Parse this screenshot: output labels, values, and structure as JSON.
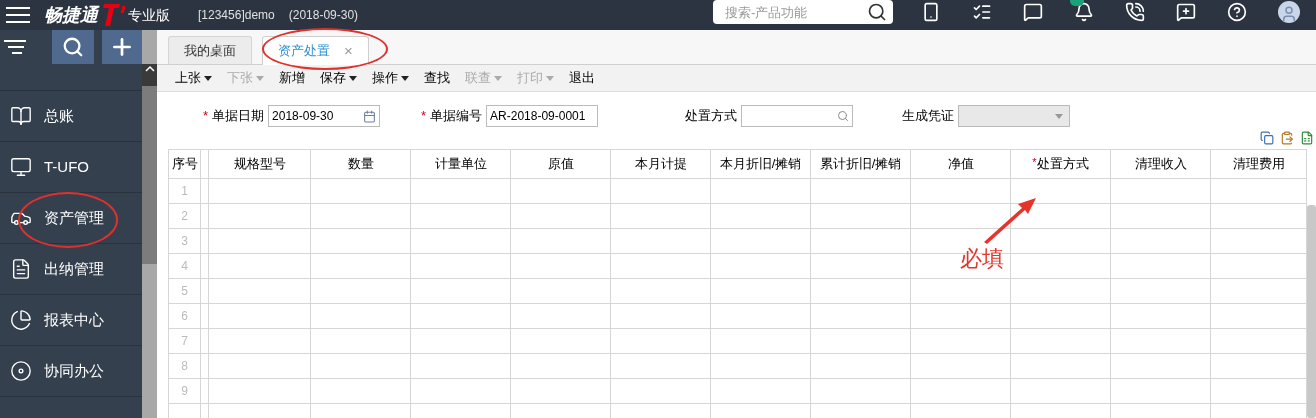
{
  "header": {
    "logo": "畅捷通",
    "edition": "专业版",
    "account": "[123456]demo",
    "date": "(2018-09-30)",
    "search": {
      "placeholder": "搜索-产品功能"
    }
  },
  "sidebar": {
    "items": [
      {
        "label": "总账",
        "selected": false
      },
      {
        "label": "T-UFO",
        "selected": false
      },
      {
        "label": "资产管理",
        "selected": false
      },
      {
        "label": "出纳管理",
        "selected": false
      },
      {
        "label": "报表中心",
        "selected": false
      },
      {
        "label": "协同办公",
        "selected": false
      }
    ]
  },
  "tabs": [
    {
      "label": "我的桌面",
      "selected": false
    },
    {
      "label": "资产处置",
      "selected": true,
      "close": "×"
    }
  ],
  "toolbar": [
    {
      "label": "上张",
      "dropdown": true,
      "disabled": false
    },
    {
      "label": "下张",
      "dropdown": true,
      "disabled": true
    },
    {
      "label": "新增",
      "dropdown": false,
      "disabled": false
    },
    {
      "label": "保存",
      "dropdown": true,
      "disabled": false
    },
    {
      "label": "操作",
      "dropdown": true,
      "disabled": false
    },
    {
      "label": "查找",
      "dropdown": false,
      "disabled": false
    },
    {
      "label": "联查",
      "dropdown": true,
      "disabled": true
    },
    {
      "label": "打印",
      "dropdown": true,
      "disabled": true
    },
    {
      "label": "退出",
      "dropdown": false,
      "disabled": false
    }
  ],
  "form": [
    {
      "label": "单据日期",
      "required_mark": "*",
      "kind": "date",
      "value": "2018-09-30"
    },
    {
      "label": "单据编号",
      "required_mark": "*",
      "kind": "text",
      "value": "AR-2018-09-0001"
    },
    {
      "label": "处置方式",
      "kind": "lookup"
    },
    {
      "label": "生成凭证",
      "kind": "select",
      "disabled": true
    }
  ],
  "table": {
    "columns": [
      {
        "label": "序号"
      },
      {
        "label": "规格型号"
      },
      {
        "label": "数量"
      },
      {
        "label": "计量单位"
      },
      {
        "label": "原值"
      },
      {
        "label": "本月计提"
      },
      {
        "label": "本月折旧/摊销"
      },
      {
        "label": "累计折旧/摊销"
      },
      {
        "label": "净值"
      },
      {
        "label": "处置方式",
        "required_mark": "*"
      },
      {
        "label": "清理收入"
      },
      {
        "label": "清理费用"
      }
    ],
    "rows": [
      "1",
      "2",
      "3",
      "4",
      "5",
      "6",
      "7",
      "8",
      "9"
    ]
  },
  "annotation": {
    "text": "必填"
  }
}
